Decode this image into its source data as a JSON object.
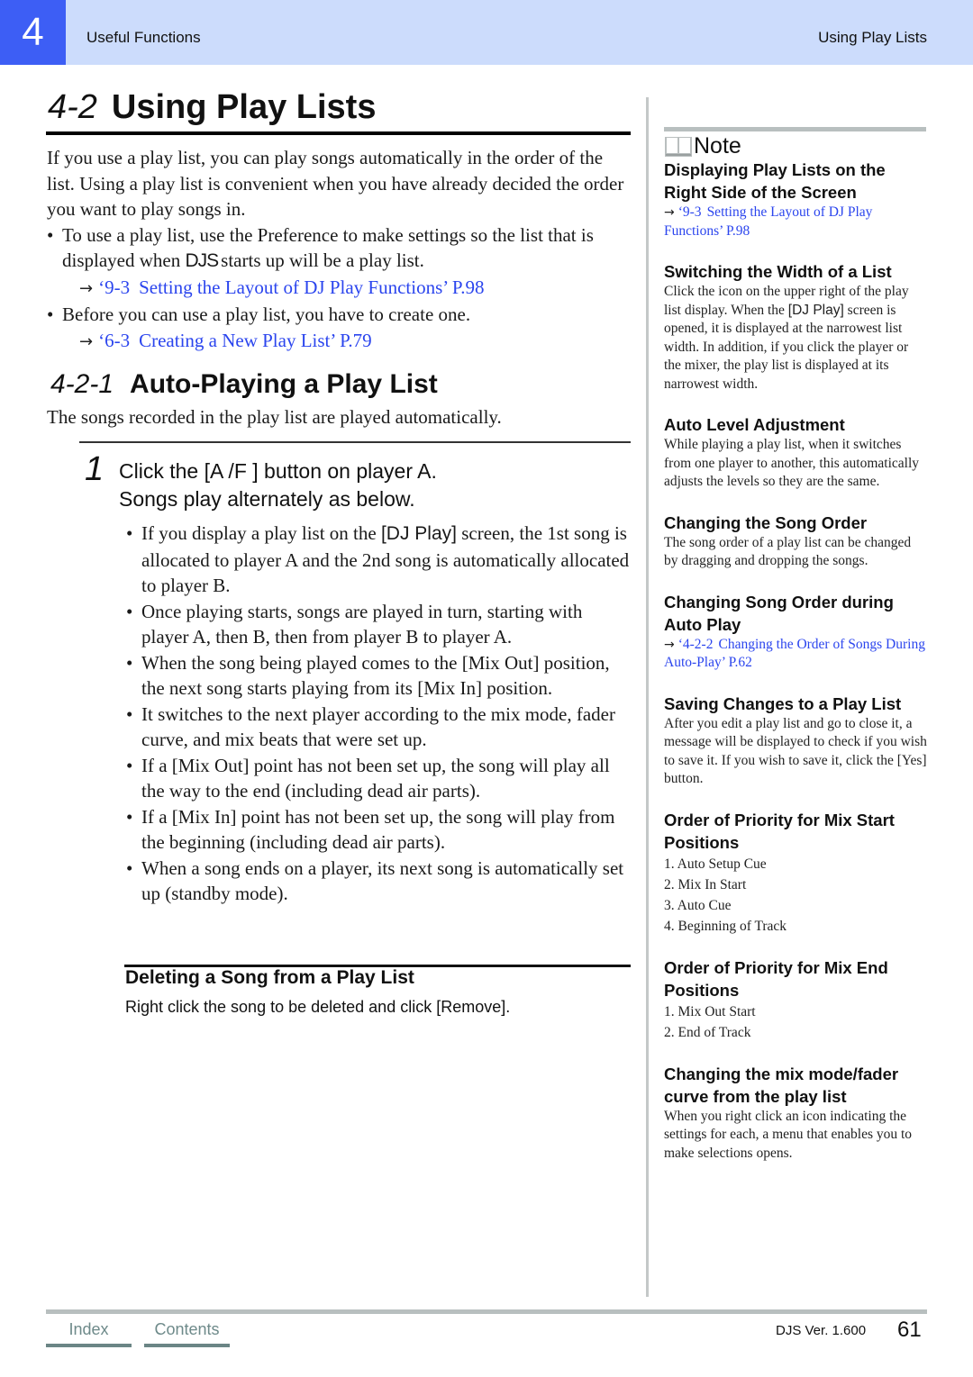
{
  "header": {
    "chapter_number": "4",
    "section_left": "Useful Functions",
    "section_right": "Using Play Lists"
  },
  "colors": {
    "header_bg": "#ccdcfc",
    "chapter_box": "#3d5ef5",
    "link": "#2b45ee",
    "footer_tab": "#6b8585"
  },
  "title": {
    "number": "4-2",
    "text": "Using Play Lists"
  },
  "intro": {
    "paragraph": "If you use a play list, you can play songs automatically in the order of the list. Using a play list is convenient when you have already decided the order you want to play songs in.",
    "bullet1_pre": "To use a play list, use the Preference to make settings so the list that is displayed when ",
    "bullet1_app": "DJS",
    "bullet1_post": "starts up will be a play list.",
    "xref1": {
      "arrow": "→",
      "num": "‘9-3",
      "text": "Setting the Layout of DJ Play Functions’ P.98"
    },
    "bullet2": "Before you can use a play list, you have to create one.",
    "xref2": {
      "arrow": "→",
      "num": "‘6-3",
      "text": "Creating a New Play List’ P.79"
    }
  },
  "subsection": {
    "number": "4-2-1",
    "text": "Auto-Playing a Play List",
    "description": "The songs recorded in the play list are played automatically."
  },
  "step": {
    "number": "1",
    "line1": "Click the [A /F ] button on player A.",
    "line2": "Songs play alternately as below.",
    "bullets": [
      {
        "pre": "If you display a play list on the ",
        "ui": "[DJ Play]",
        "post": " screen, the 1st song is allocated to player A and the 2nd song is automatically allocated to player B."
      },
      {
        "pre": "Once playing starts, songs are played in turn, starting with player A, then B, then from player B to player A."
      },
      {
        "pre": "When the song being played comes to the [Mix Out] position, the next song starts playing from its [Mix In] position."
      },
      {
        "pre": "It switches to the next player according to the mix mode, fader curve, and mix beats that were set up."
      },
      {
        "pre": "If a [Mix Out] point has not been set up, the song will play all the way to the end (including dead air parts)."
      },
      {
        "pre": "If a [Mix In] point has not been set up, the song will play from the beginning (including dead air parts)."
      },
      {
        "pre": "When a song ends on a player, its next song is automatically set up (standby mode)."
      }
    ]
  },
  "delete_section": {
    "title": "Deleting a Song from a Play List",
    "text": "Right click the song to be deleted and click [Remove]."
  },
  "note": {
    "label": "Note",
    "icon": "open-book-icon",
    "sections": [
      {
        "title": "Displaying Play Lists on the Right Side of the Screen",
        "xref": {
          "arrow": "→",
          "num": "‘9-3",
          "text": "Setting the Layout of DJ Play Functions’ P.98"
        }
      },
      {
        "title": "Switching the Width of a List",
        "body_pre": "Click the icon on the upper right of the play list display. When the ",
        "body_ui": "[DJ Play]",
        "body_post": " screen is opened, it is displayed at the narrowest list width. In addition, if you click the player or the mixer, the play list is displayed at its narrowest width."
      },
      {
        "title": "Auto Level Adjustment",
        "body_pre": "While playing a play list, when it switches from one player to another, this automatically adjusts the levels so they are the same."
      },
      {
        "title": "Changing the Song Order",
        "body_pre": "The song order of a play list can be changed by dragging and dropping the songs."
      },
      {
        "title": "Changing Song Order during Auto Play",
        "xref": {
          "arrow": "→",
          "num": "‘4-2-2",
          "text": "Changing the Order of Songs During Auto-Play’ P.62"
        }
      },
      {
        "title": "Saving Changes to a Play List",
        "body_pre": "After you edit a play list and go to close it, a message will be displayed to check if you wish to save it. If you wish to save it, click the [Yes] button."
      },
      {
        "title": "Order of Priority for Mix Start Positions",
        "list": [
          "1. Auto Setup Cue",
          "2. Mix In Start",
          "3. Auto Cue",
          "4. Beginning of Track"
        ]
      },
      {
        "title": "Order of Priority for Mix End Positions",
        "list": [
          "1. Mix Out Start",
          "2. End of Track"
        ]
      },
      {
        "title": "Changing the mix mode/fader curve from the play list",
        "body_pre": "When you right click an icon indicating the settings for each, a menu that enables you to make selections opens."
      }
    ]
  },
  "footer": {
    "index_label": "Index",
    "contents_label": "Contents",
    "version": "DJS Ver. 1.600",
    "page_number": "61"
  }
}
